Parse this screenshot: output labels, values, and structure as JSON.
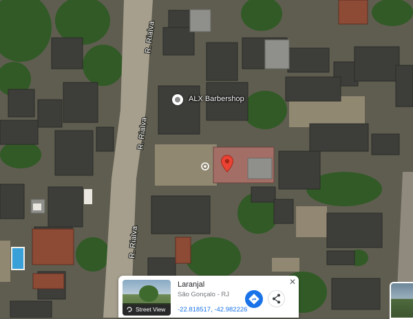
{
  "map": {
    "imagery": "satellite",
    "streets": [
      {
        "label": "R. Rialva"
      },
      {
        "label": "R. Rialva"
      },
      {
        "label": "R. Rialva"
      }
    ],
    "poi": {
      "label": "ALX Barbershop",
      "icon": "place-pin-icon"
    },
    "selected_marker": {
      "icon": "red-location-pin-icon",
      "color": "#ea4335"
    }
  },
  "place_card": {
    "name": "Laranjal",
    "address": "São Gonçalo - RJ",
    "coordinates": "-22.818517, -42.982226",
    "street_view_label": "Street View",
    "directions_icon": "directions-icon",
    "share_icon": "share-icon",
    "close_icon": "close-icon",
    "accent": "#1a73e8"
  }
}
